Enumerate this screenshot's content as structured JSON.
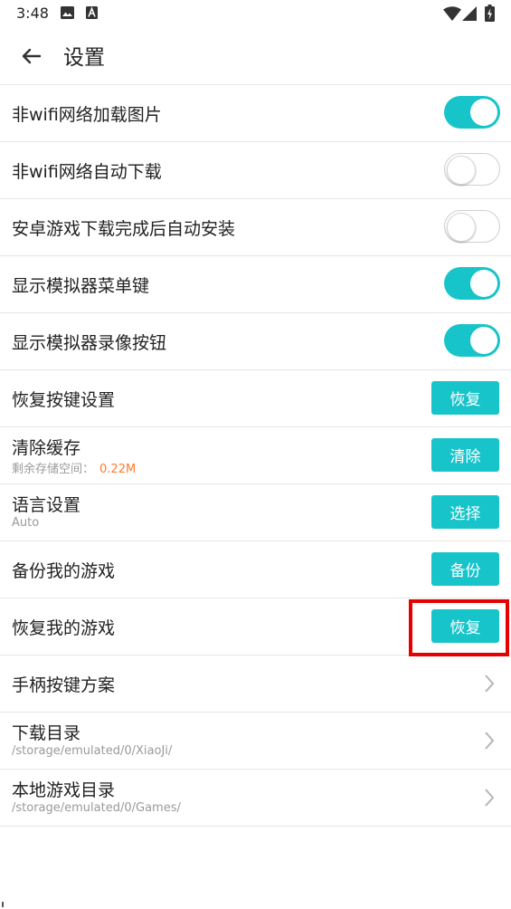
{
  "status_bar": {
    "time": "3:48"
  },
  "header": {
    "title": "设置"
  },
  "settings": [
    {
      "label": "非wifi网络加载图片",
      "control": "toggle",
      "on": true
    },
    {
      "label": "非wifi网络自动下载",
      "control": "toggle",
      "on": false
    },
    {
      "label": "安卓游戏下载完成后自动安装",
      "control": "toggle",
      "on": false
    },
    {
      "label": "显示模拟器菜单键",
      "control": "toggle",
      "on": true
    },
    {
      "label": "显示模拟器录像按钮",
      "control": "toggle",
      "on": true
    },
    {
      "label": "恢复按键设置",
      "control": "button",
      "button_label": "恢复"
    },
    {
      "label": "清除缓存",
      "sublabel": "剩余存储空间：",
      "subvalue": "0.22M",
      "control": "button",
      "button_label": "清除"
    },
    {
      "label": "语言设置",
      "sublabel": "Auto",
      "control": "button",
      "button_label": "选择"
    },
    {
      "label": "备份我的游戏",
      "control": "button",
      "button_label": "备份"
    },
    {
      "label": "恢复我的游戏",
      "control": "button",
      "button_label": "恢复",
      "highlighted": true
    },
    {
      "label": "手柄按键方案",
      "control": "chevron"
    },
    {
      "label": "下载目录",
      "sublabel": "/storage/emulated/0/XiaoJi/",
      "control": "chevron"
    },
    {
      "label": "本地游戏目录",
      "sublabel": "/storage/emulated/0/Games/",
      "control": "chevron"
    }
  ],
  "colors": {
    "accent": "#17c4c9",
    "highlight": "#e60000",
    "value": "#ff7a2e"
  }
}
